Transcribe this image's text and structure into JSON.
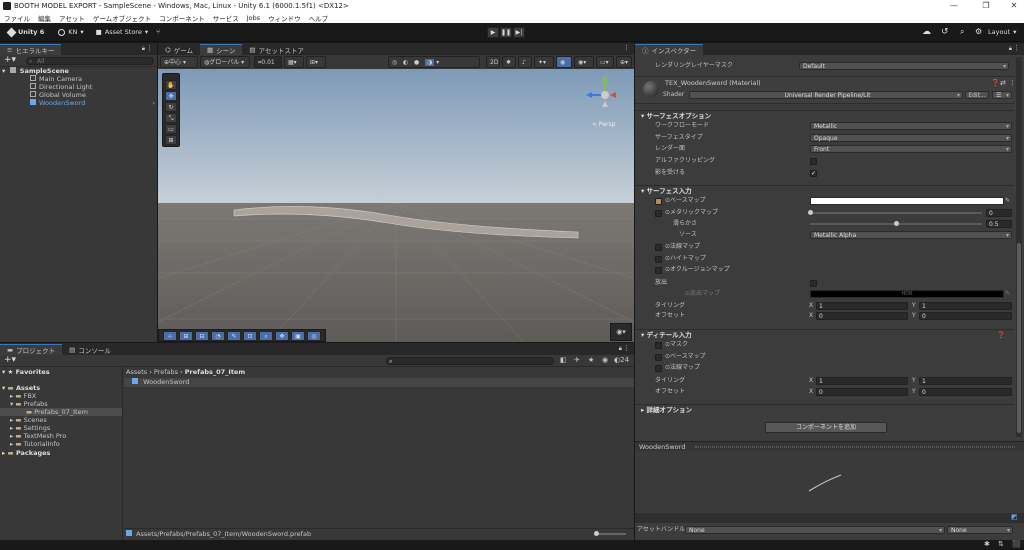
{
  "window": {
    "title": "BOOTH MODEL EXPORT - SampleScene - Windows, Mac, Linux - Unity 6.1 (6000.1.5f1) <DX12>",
    "minimize": "—",
    "maximize": "❐",
    "close": "✕"
  },
  "menu": [
    "ファイル",
    "編集",
    "アセット",
    "ゲームオブジェクト",
    "コンポーネント",
    "サービス",
    "Jobs",
    "ウィンドウ",
    "ヘルプ"
  ],
  "toolbar": {
    "unity_label": "Unity 6",
    "account": "KN",
    "asset_store": "Asset Store",
    "layout": "Layout"
  },
  "hierarchy": {
    "tab": "ヒエラルキー",
    "search_placeholder": "All",
    "scene": "SampleScene",
    "items": [
      "Main Camera",
      "Directional Light",
      "Global Volume",
      "WoodenSword"
    ]
  },
  "scene_tabs": {
    "game": "ゲーム",
    "scene": "シーン",
    "asset_store": "アセットストア"
  },
  "scene_toolbar": {
    "pivot": "中心",
    "space": "グローバル",
    "snap": "0.01"
  },
  "gizmo": {
    "persp": "< Persp"
  },
  "project": {
    "tabs": [
      "プロジェクト",
      "コンソール"
    ],
    "count": "24",
    "favorites": "Favorites",
    "assets": "Assets",
    "folders": [
      "FBX",
      "Prefabs",
      "Prefabs_07_Item",
      "Scenes",
      "Settings",
      "TextMesh Pro",
      "TutorialInfo"
    ],
    "packages": "Packages",
    "breadcrumb": [
      "Assets",
      "Prefabs",
      "Prefabs_07_Item"
    ],
    "item": "WoodenSword",
    "status_path": "Assets/Prefabs/Prefabs_07_Item/WoodenSword.prefab"
  },
  "inspector": {
    "tab": "インスペクター",
    "top_row_label": "レンダリングレイヤーマスク",
    "top_row_value": "Default",
    "material_name": "TEX_WoodenSword (Material)",
    "shader_label": "Shader",
    "shader_value": "Universal Render Pipeline/Lit",
    "edit_button": "Edit...",
    "surface_options": "サーフェスオプション",
    "workflow_label": "ワークフローモード",
    "workflow_value": "Metallic",
    "surface_type_label": "サーフェスタイプ",
    "surface_type_value": "Opaque",
    "render_face_label": "レンダー面",
    "render_face_value": "Front",
    "alpha_clip_label": "アルファクリッピング",
    "receive_shadows_label": "影を受ける",
    "surface_inputs": "サーフェス入力",
    "base_map": "ベースマップ",
    "metallic_map": "メタリックマップ",
    "metallic_value": "0",
    "smoothness": "滑らかさ",
    "smoothness_value": "0.5",
    "source": "ソース",
    "source_value": "Metallic Alpha",
    "normal_map": "法線マップ",
    "height_map": "ハイトマップ",
    "occlusion_map": "オクルージョンマップ",
    "emission": "放出",
    "emission_map": "放出マップ",
    "hdr": "HDR",
    "tiling": "タイリング",
    "offset": "オフセット",
    "x": "X",
    "y": "Y",
    "tiling_x": "1",
    "tiling_y": "1",
    "offset_x": "0",
    "offset_y": "0",
    "detail_inputs": "ディテール入力",
    "mask": "マスク",
    "detail_base_map": "ベースマップ",
    "detail_normal_map": "法線マップ",
    "detail_tiling_x": "1",
    "detail_tiling_y": "1",
    "detail_offset_x": "0",
    "detail_offset_y": "0",
    "advanced_options": "詳細オプション",
    "add_component": "コンポーネントを追加",
    "preview_title": "WoodenSword",
    "asset_bundle_label": "アセットバンドル",
    "asset_bundle_value": "None",
    "asset_bundle_variant": "None"
  },
  "colors": {
    "accent": "#3a79bb",
    "panel": "#383838",
    "dark": "#282828"
  },
  "smoothness_fraction": 0.5
}
